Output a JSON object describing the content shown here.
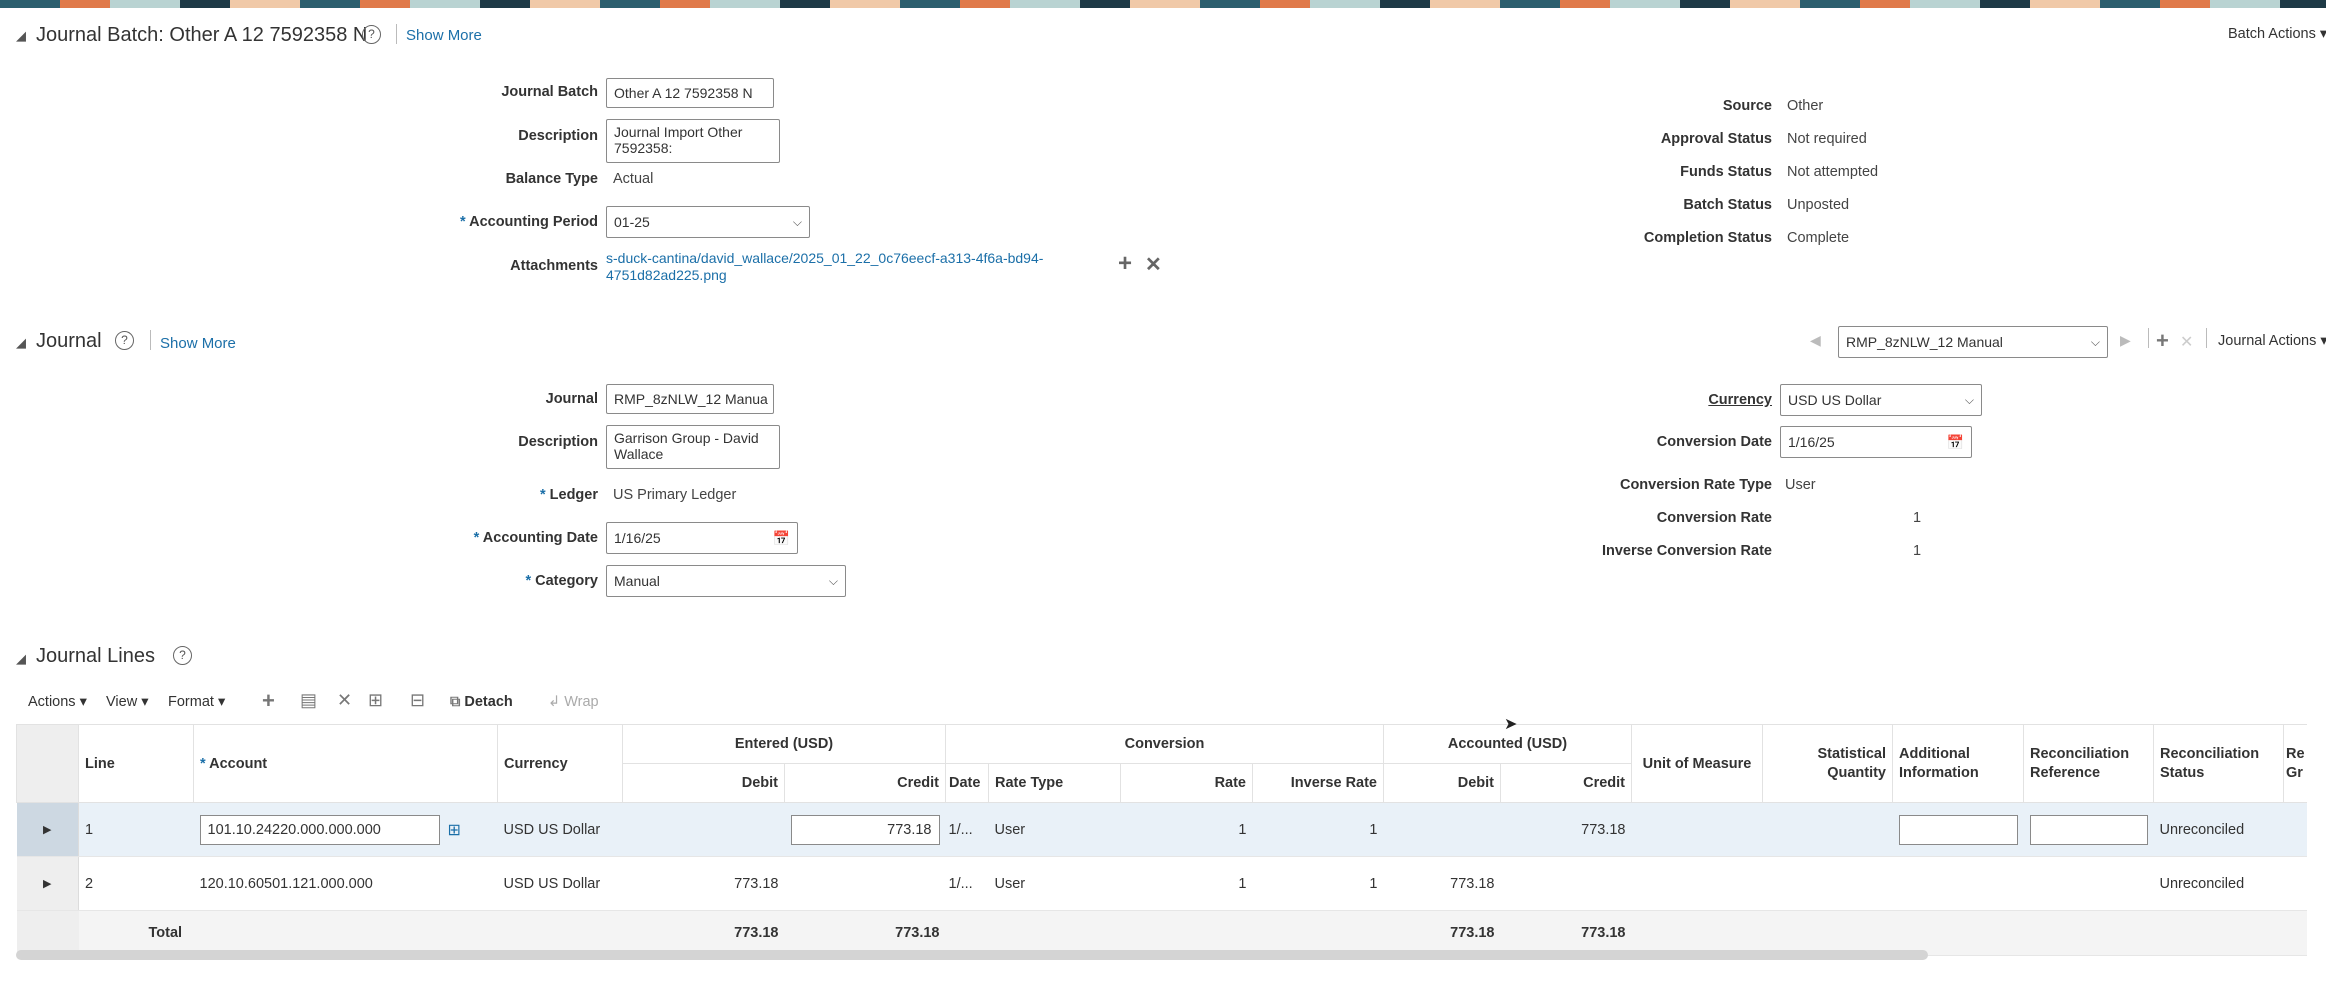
{
  "batch": {
    "title": "Journal Batch: Other A 12 7592358 N",
    "show_more": "Show More",
    "actions": "Batch Actions",
    "fields": {
      "journal_batch_label": "Journal Batch",
      "journal_batch_value": "Other A 12 7592358 N",
      "description_label": "Description",
      "description_value": "Journal Import Other 7592358:",
      "balance_type_label": "Balance Type",
      "balance_type_value": "Actual",
      "accounting_period_label": "Accounting Period",
      "accounting_period_value": "01-25",
      "attachments_label": "Attachments",
      "attachment_line1": "s-duck-cantina/david_wallace/2025_01_22_0c76eecf-a313-4f6a-bd94-",
      "attachment_line2": "4751d82ad225.png"
    },
    "status": {
      "source_label": "Source",
      "source_value": "Other",
      "approval_label": "Approval Status",
      "approval_value": "Not required",
      "funds_label": "Funds Status",
      "funds_value": "Not attempted",
      "batch_label": "Batch Status",
      "batch_value": "Unposted",
      "completion_label": "Completion Status",
      "completion_value": "Complete"
    }
  },
  "journal": {
    "title": "Journal",
    "show_more": "Show More",
    "selector_value": "RMP_8zNLW_12 Manual",
    "actions": "Journal Actions",
    "fields": {
      "journal_label": "Journal",
      "journal_value": "RMP_8zNLW_12 Manua",
      "description_label": "Description",
      "description_value": "Garrison Group - David Wallace",
      "ledger_label": "Ledger",
      "ledger_value": "US Primary Ledger",
      "accounting_date_label": "Accounting Date",
      "accounting_date_value": "1/16/25",
      "category_label": "Category",
      "category_value": "Manual"
    },
    "conversion": {
      "currency_label": "Currency",
      "currency_value": "USD US Dollar",
      "conv_date_label": "Conversion Date",
      "conv_date_value": "1/16/25",
      "rate_type_label": "Conversion Rate Type",
      "rate_type_value": "User",
      "rate_label": "Conversion Rate",
      "rate_value": "1",
      "inverse_label": "Inverse Conversion Rate",
      "inverse_value": "1"
    }
  },
  "lines": {
    "title": "Journal Lines",
    "toolbar": {
      "actions": "Actions",
      "view": "View",
      "format": "Format",
      "detach": "Detach",
      "wrap": "Wrap"
    },
    "headers": {
      "line": "Line",
      "account": "Account",
      "currency": "Currency",
      "entered": "Entered (USD)",
      "conversion": "Conversion",
      "accounted": "Accounted (USD)",
      "debit": "Debit",
      "credit": "Credit",
      "date": "Date",
      "rate_type": "Rate Type",
      "rate": "Rate",
      "inverse_rate": "Inverse Rate",
      "uom": "Unit of Measure",
      "stat_qty_1": "Statistical",
      "stat_qty_2": "Quantity",
      "add_info_1": "Additional",
      "add_info_2": "Information",
      "recon_ref_1": "Reconciliation",
      "recon_ref_2": "Reference",
      "recon_status_1": "Reconciliation",
      "recon_status_2": "Status",
      "more_1": "Re",
      "more_2": "Gr"
    },
    "rows": [
      {
        "line": "1",
        "account": "101.10.24220.000.000.000",
        "currency": "USD US Dollar",
        "entered_debit": "",
        "entered_credit": "773.18",
        "date": "1/...",
        "rate_type": "User",
        "rate": "1",
        "inverse_rate": "1",
        "acc_debit": "",
        "acc_credit": "773.18",
        "recon_status": "Unreconciled"
      },
      {
        "line": "2",
        "account": "120.10.60501.121.000.000",
        "currency": "USD US Dollar",
        "entered_debit": "773.18",
        "entered_credit": "",
        "date": "1/...",
        "rate_type": "User",
        "rate": "1",
        "inverse_rate": "1",
        "acc_debit": "773.18",
        "acc_credit": "",
        "recon_status": "Unreconciled"
      }
    ],
    "total": {
      "label": "Total",
      "entered_debit": "773.18",
      "entered_credit": "773.18",
      "acc_debit": "773.18",
      "acc_credit": "773.18"
    }
  }
}
